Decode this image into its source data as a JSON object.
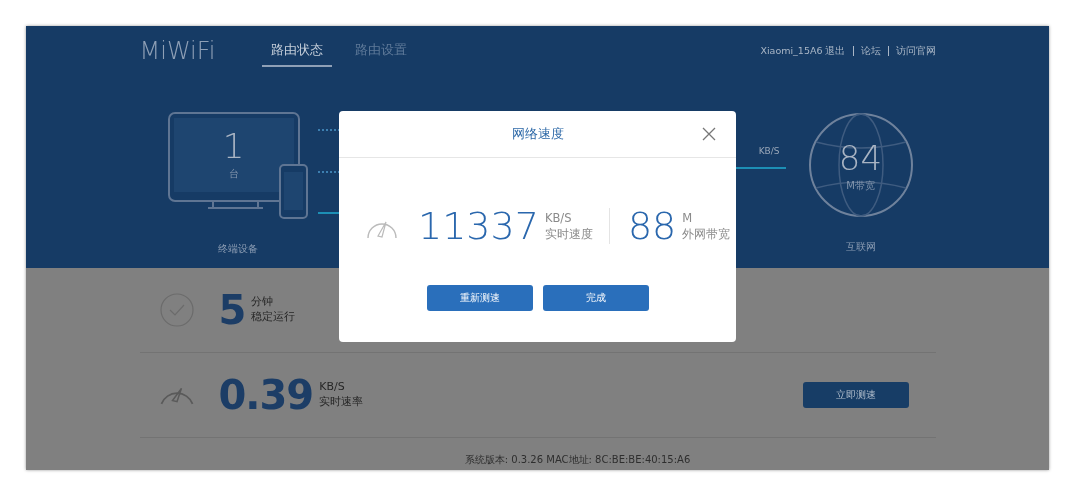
{
  "header": {
    "logo": "MiWiFi",
    "tabs": [
      {
        "label": "路由状态",
        "selected": true
      },
      {
        "label": "路由设置",
        "selected": false
      }
    ],
    "links": [
      "Xiaomi_15A6 退出",
      "论坛",
      "访问官网"
    ]
  },
  "overview": {
    "devices": {
      "count": "1",
      "unit": "台",
      "label": "终端设备"
    },
    "speed": {
      "unit": "KB/S"
    },
    "internet": {
      "value": "84",
      "unit": "M带宽",
      "label": "互联网"
    }
  },
  "stats": [
    {
      "kind": "uptime",
      "value": "5",
      "unit": "分钟",
      "label": "稳定运行"
    },
    {
      "kind": "speed",
      "value": "0.39",
      "unit": "KB/S",
      "label": "实时速率",
      "button": "立即测速"
    }
  ],
  "footer": "系统版本: 0.3.26  MAC地址: 8C:BE:BE:40:15:A6",
  "dialog": {
    "title": "网络速度",
    "speed": {
      "value": "11337",
      "unit": "KB/S",
      "label": "实时速度"
    },
    "bandwidth": {
      "value": "88",
      "unit": "M",
      "label": "外网带宽"
    },
    "buttons": [
      {
        "label": "重新测速",
        "kind": "primary"
      },
      {
        "label": "完成",
        "kind": "primary"
      }
    ]
  }
}
